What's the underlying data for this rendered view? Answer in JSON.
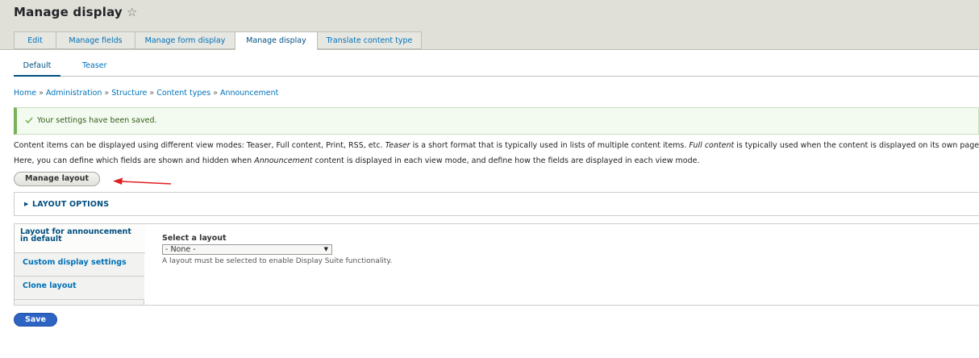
{
  "header": {
    "title": "Manage display",
    "star_icon": "star-outline-icon"
  },
  "tabs": [
    {
      "label": "Edit",
      "active": false
    },
    {
      "label": "Manage fields",
      "active": false
    },
    {
      "label": "Manage form display",
      "active": false
    },
    {
      "label": "Manage display",
      "active": true
    },
    {
      "label": "Translate content type",
      "active": false
    }
  ],
  "subtabs": [
    {
      "label": "Default",
      "active": true
    },
    {
      "label": "Teaser",
      "active": false
    }
  ],
  "breadcrumb": {
    "items": [
      "Home",
      "Administration",
      "Structure",
      "Content types",
      "Announcement"
    ],
    "separator": "»"
  },
  "status_message": {
    "text": "Your settings have been saved.",
    "color": "#77b259"
  },
  "description": {
    "line1_prefix": "Content items can be displayed using different view modes: Teaser, Full content, Print, RSS, etc. ",
    "line1_em1": "Teaser",
    "line1_mid": " is a short format that is typically used in lists of multiple content items. ",
    "line1_em2": "Full content",
    "line1_suffix": " is typically used when the content is displayed on its own page.",
    "line2_prefix": "Here, you can define which fields are shown and hidden when ",
    "line2_em": "Announcement",
    "line2_suffix": " content is displayed in each view mode, and define how the fields are displayed in each view mode."
  },
  "manage_layout_button": "Manage layout",
  "layout_options": {
    "label": "LAYOUT OPTIONS"
  },
  "vertical_tabs": {
    "items": [
      "Layout for announcement in default",
      "Custom display settings",
      "Clone layout"
    ],
    "select_label": "Select a layout",
    "select_value": "- None -",
    "select_help": "A layout must be selected to enable Display Suite functionality."
  },
  "save_button": "Save",
  "colors": {
    "link": "#0071b8",
    "primary_button": "#2d64c4",
    "annotation_arrow": "#e02020"
  }
}
